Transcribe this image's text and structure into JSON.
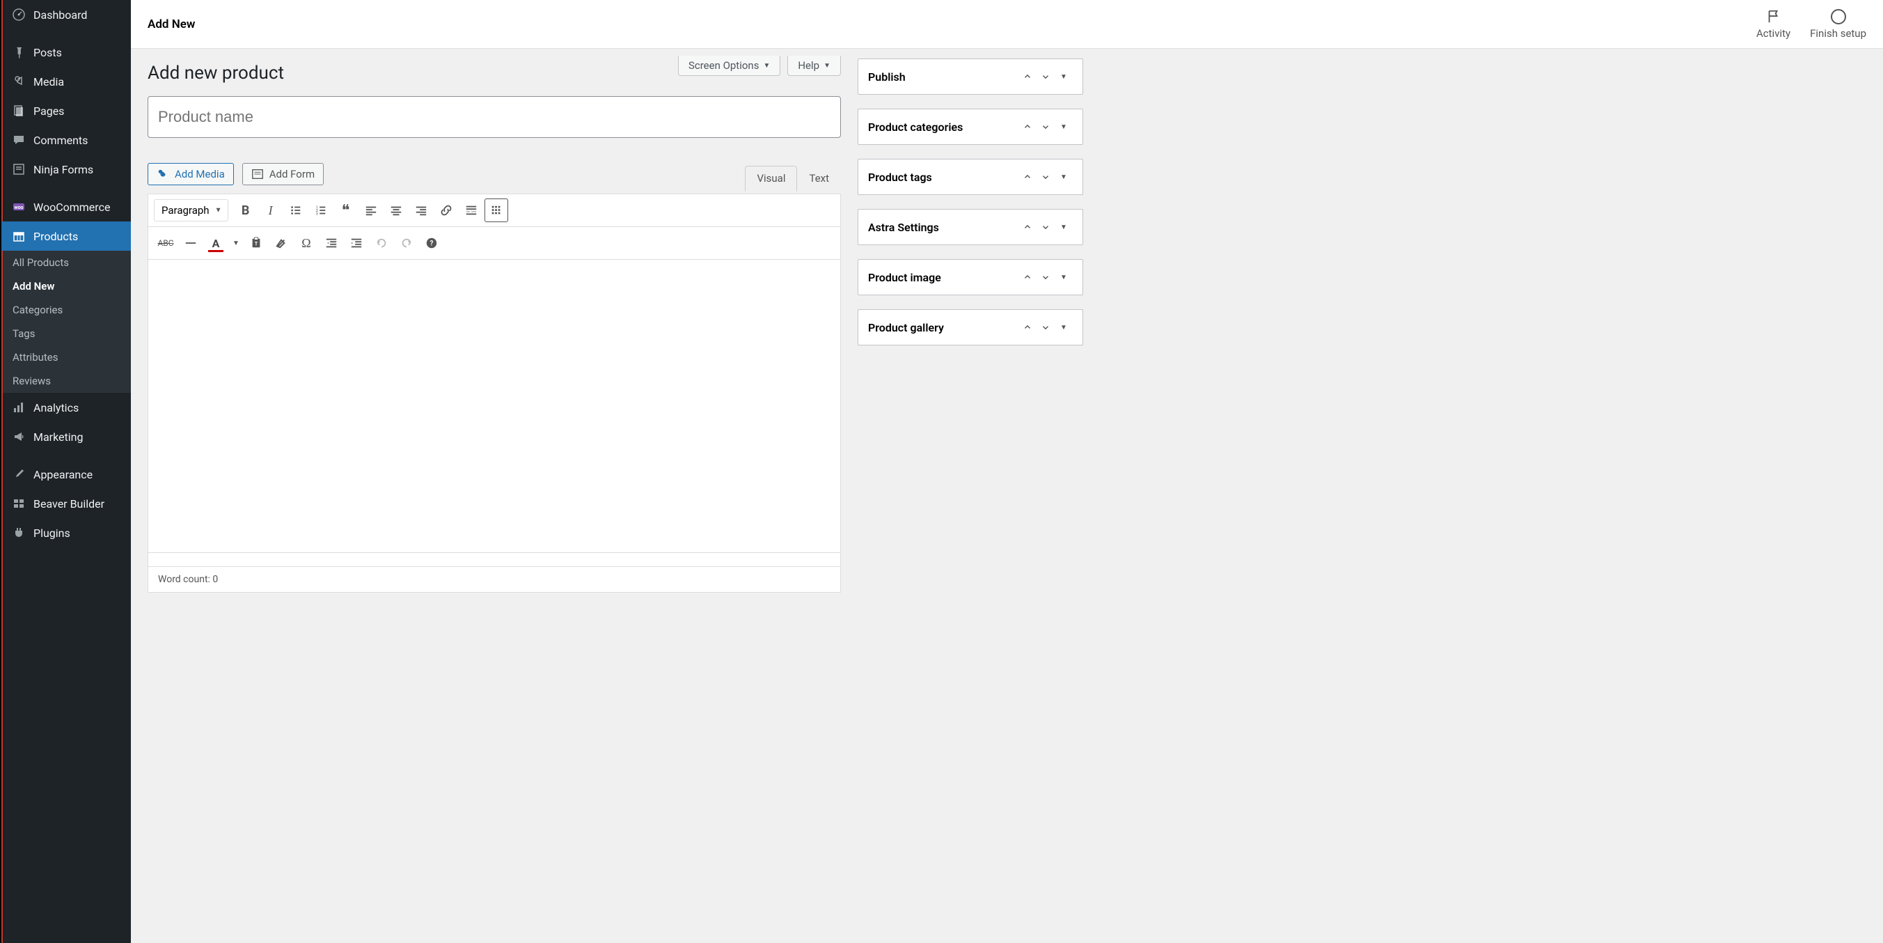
{
  "sidebar": {
    "items": [
      {
        "icon": "dashboard",
        "label": "Dashboard"
      },
      {
        "icon": "pin",
        "label": "Posts"
      },
      {
        "icon": "media",
        "label": "Media"
      },
      {
        "icon": "pages",
        "label": "Pages"
      },
      {
        "icon": "comment",
        "label": "Comments"
      },
      {
        "icon": "form",
        "label": "Ninja Forms"
      },
      {
        "icon": "woo",
        "label": "WooCommerce"
      },
      {
        "icon": "product",
        "label": "Products"
      },
      {
        "icon": "analytics",
        "label": "Analytics"
      },
      {
        "icon": "marketing",
        "label": "Marketing"
      },
      {
        "icon": "appearance",
        "label": "Appearance"
      },
      {
        "icon": "beaver",
        "label": "Beaver Builder"
      },
      {
        "icon": "plugins",
        "label": "Plugins"
      }
    ],
    "submenu": [
      {
        "label": "All Products"
      },
      {
        "label": "Add New"
      },
      {
        "label": "Categories"
      },
      {
        "label": "Tags"
      },
      {
        "label": "Attributes"
      },
      {
        "label": "Reviews"
      }
    ]
  },
  "topbar": {
    "breadcrumb": "Add New",
    "activity_label": "Activity",
    "finish_label": "Finish setup"
  },
  "screen_options_label": "Screen Options",
  "help_label": "Help",
  "page_title": "Add new product",
  "title_placeholder": "Product name",
  "editor": {
    "add_media_label": "Add Media",
    "add_form_label": "Add Form",
    "visual_tab": "Visual",
    "text_tab": "Text",
    "format_select": "Paragraph",
    "word_count_label": "Word count: 0"
  },
  "metaboxes": [
    {
      "title": "Publish"
    },
    {
      "title": "Product categories"
    },
    {
      "title": "Product tags"
    },
    {
      "title": "Astra Settings"
    },
    {
      "title": "Product image"
    },
    {
      "title": "Product gallery"
    }
  ]
}
